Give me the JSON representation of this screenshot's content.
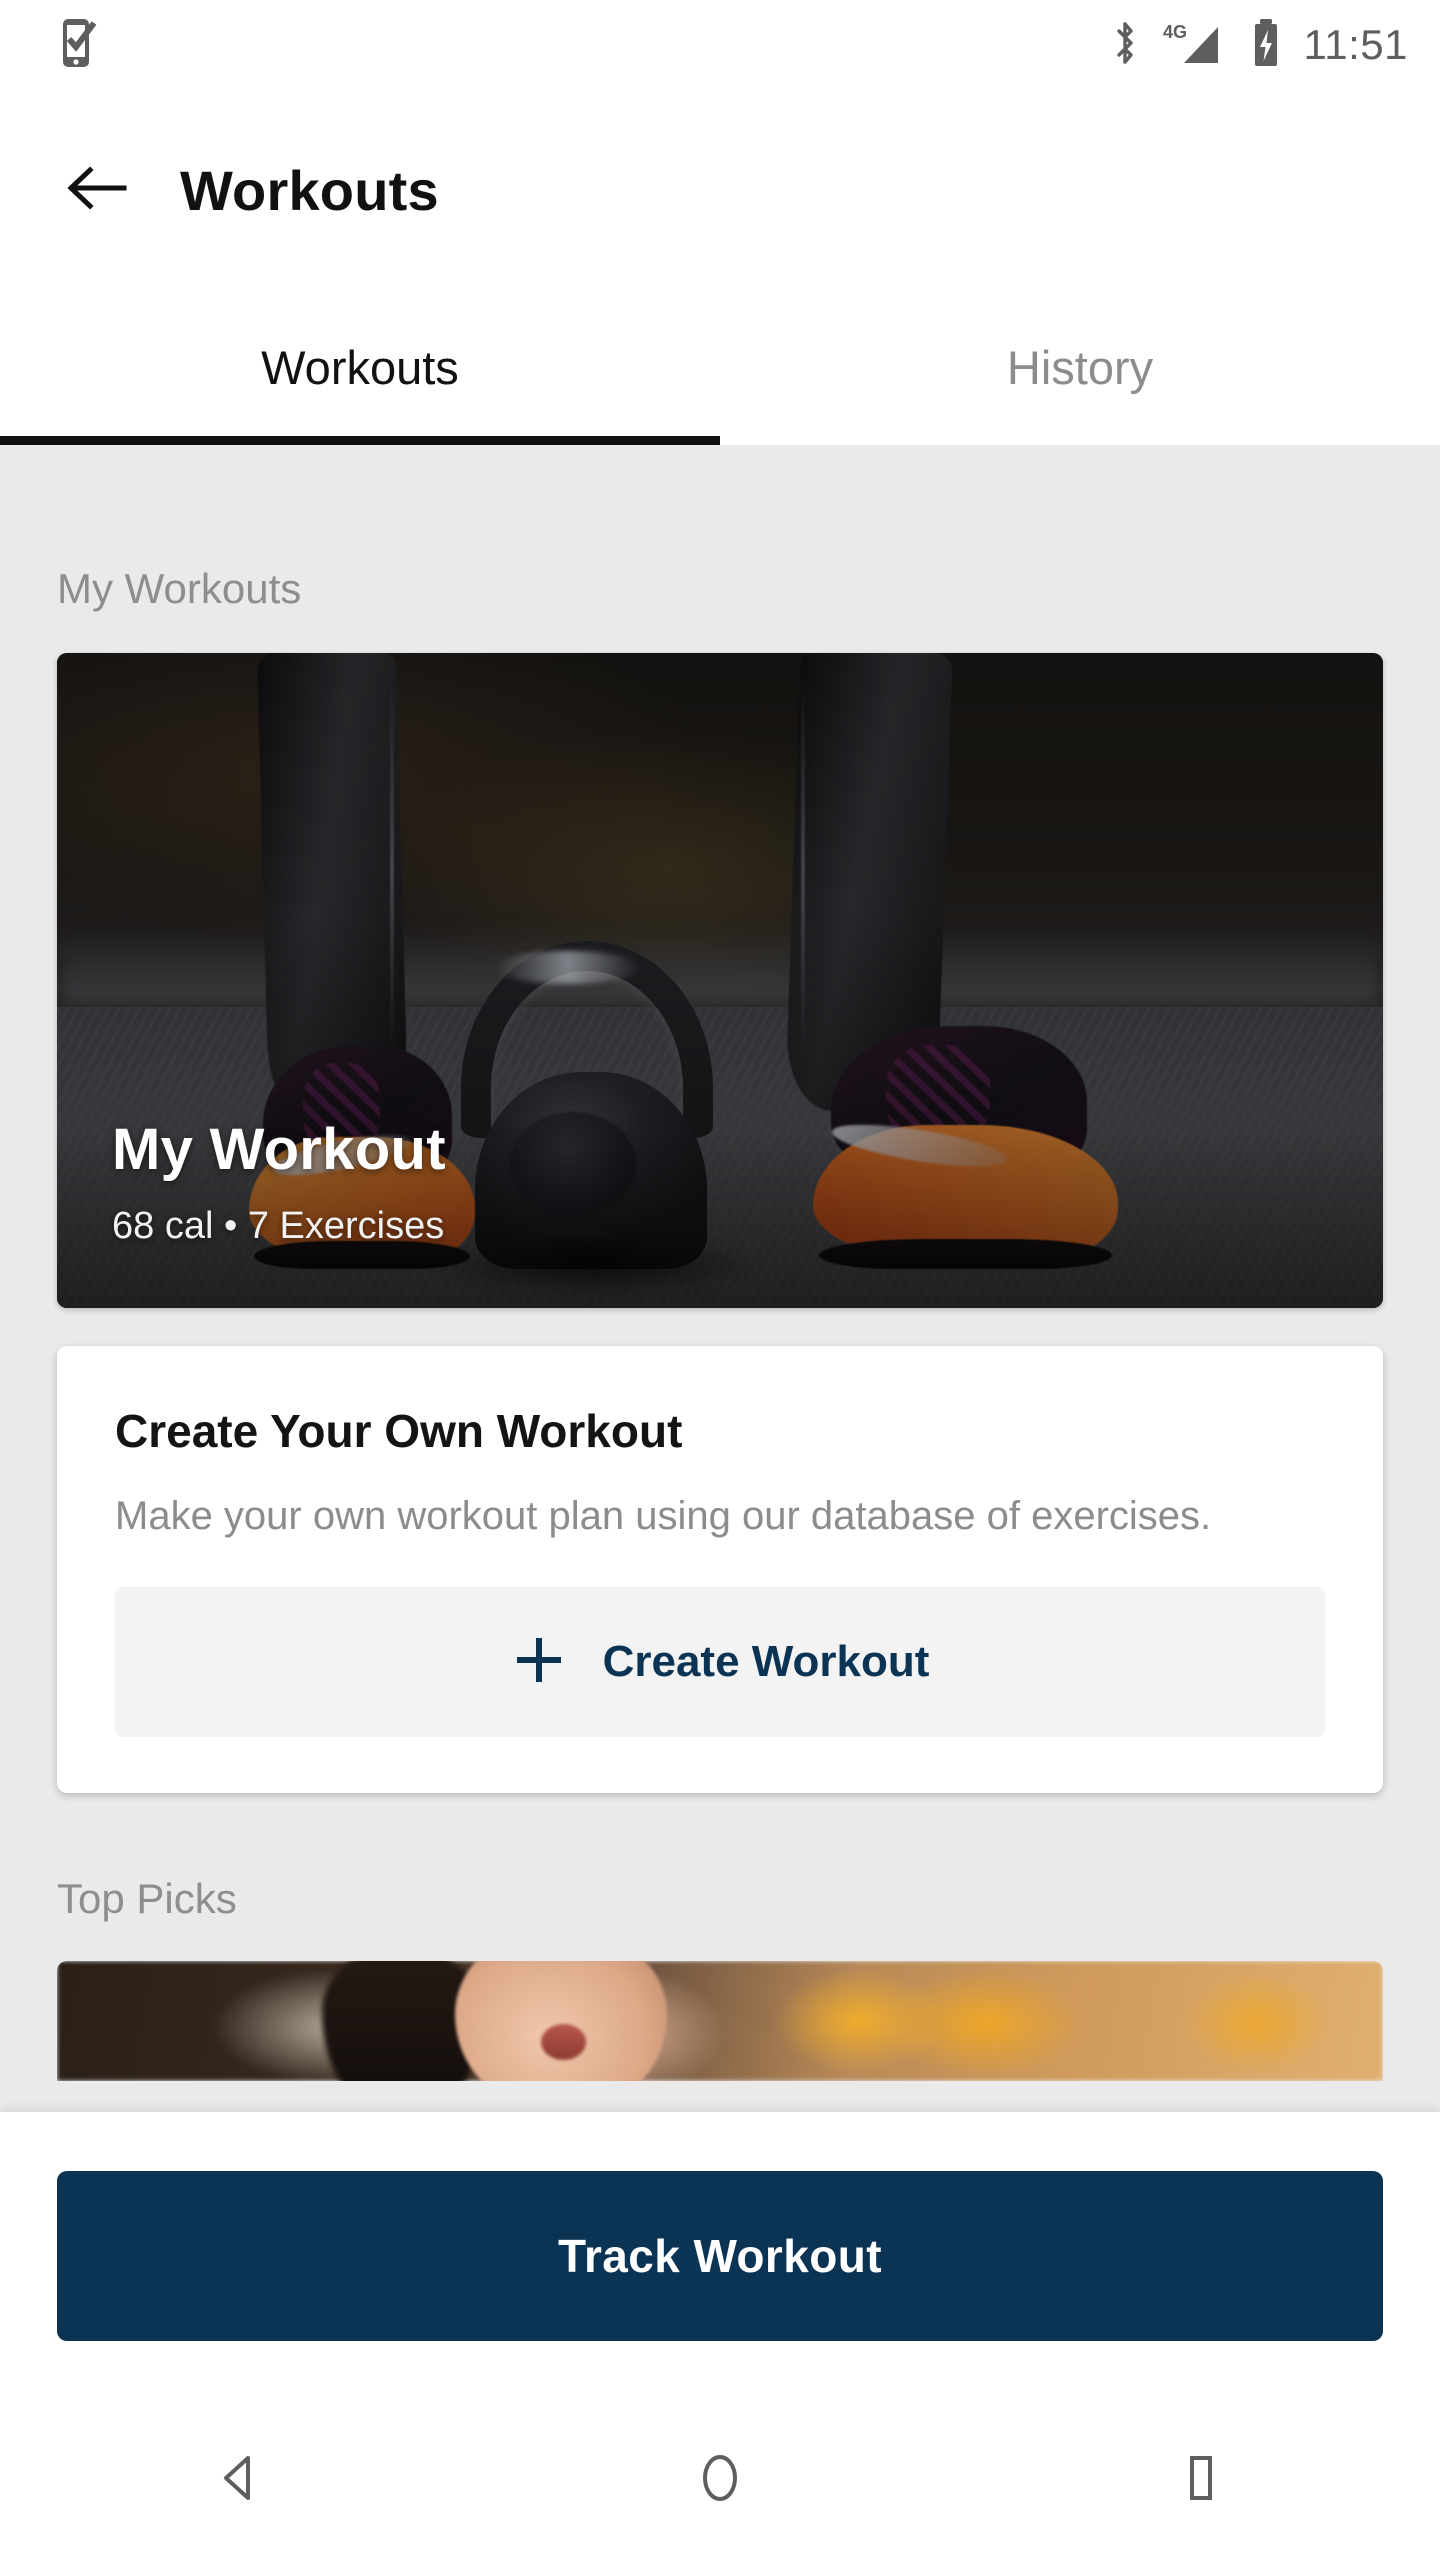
{
  "statusbar": {
    "left_icon": "phone-check-icon",
    "icons": [
      "bluetooth-icon",
      "signal-4g-icon",
      "battery-charging-icon"
    ],
    "network_label": "4G",
    "clock": "11:51"
  },
  "appbar": {
    "back_icon": "back-arrow-icon",
    "title": "Workouts"
  },
  "tabs": [
    {
      "label": "Workouts",
      "active": true
    },
    {
      "label": "History",
      "active": false
    }
  ],
  "sections": {
    "my_workouts_title": "My Workouts",
    "top_picks_title": "Top Picks"
  },
  "hero_card": {
    "title": "My Workout",
    "subtitle": "68 cal • 7 Exercises",
    "calories": "68 cal",
    "exercises": "7 Exercises",
    "image_alt": "kettlebell-gym-photo"
  },
  "create_card": {
    "title": "Create Your Own Workout",
    "description": "Make your own workout plan using our database of exercises.",
    "button_label": "Create Workout",
    "button_icon": "plus-icon"
  },
  "top_picks": {
    "peek_card_alt": "top-pick-photo"
  },
  "cta": {
    "label": "Track Workout"
  },
  "navbar": {
    "back": "nav-back-icon",
    "home": "nav-home-icon",
    "recents": "nav-recents-icon"
  },
  "colors": {
    "accent_navy": "#0b3354",
    "page_background": "#eaeaea",
    "card_background": "#ffffff",
    "muted_text": "#8e8e8e",
    "primary_text": "#111111",
    "button_surface": "#f3f3f3"
  }
}
